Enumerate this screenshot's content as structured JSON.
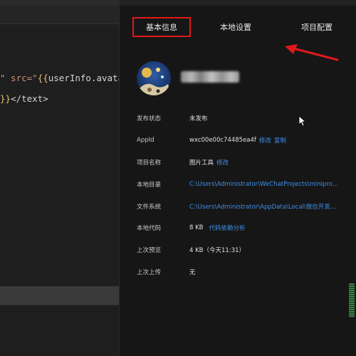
{
  "editor": {
    "line1": {
      "part1": "\" src=\"",
      "brace_open": "{{",
      "expr": "userInfo.avata"
    },
    "line2": {
      "brace_close": "}}",
      "tag": "</text>"
    }
  },
  "tabs": {
    "basic": "基本信息",
    "local": "本地设置",
    "project": "项目配置"
  },
  "info": {
    "publish_status": {
      "label": "发布状态",
      "value": "未发布"
    },
    "appid": {
      "label": "AppId",
      "value": "wxc00e00c74485ea4f",
      "edit": "修改",
      "copy": "复制"
    },
    "project_name": {
      "label": "项目名称",
      "value": "图片工具",
      "edit": "修改"
    },
    "local_dir": {
      "label": "本地目录",
      "value": "C:\\Users\\Administrator\\WeChatProjects\\miniprogr..."
    },
    "file_system": {
      "label": "文件系统",
      "value": "C:\\Users\\Administrator\\AppData\\Local\\微信开发..."
    },
    "local_code": {
      "label": "本地代码",
      "value": "8 KB",
      "link": "代码依赖分析"
    },
    "last_preview": {
      "label": "上次预览",
      "value": "4 KB（今天11:31）"
    },
    "last_upload": {
      "label": "上次上传",
      "value": "无"
    }
  },
  "colors": {
    "highlight_border": "#e0181b",
    "link": "#3f8fe6",
    "panel_bg": "#161616",
    "editor_bg": "#1e1e1e"
  },
  "icons": [
    "avatar",
    "mouse-cursor-icon",
    "annotation-arrow"
  ]
}
